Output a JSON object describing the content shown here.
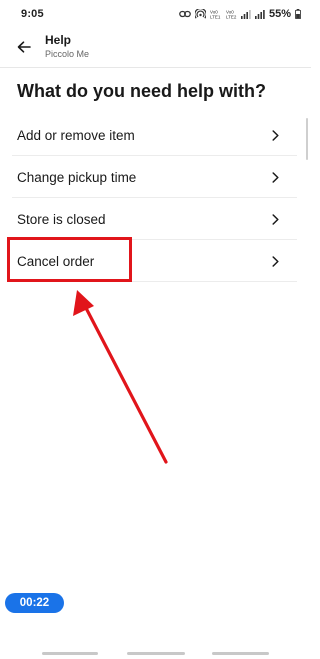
{
  "status_bar": {
    "time": "9:05",
    "battery": "55%",
    "icons": [
      "link-icon",
      "hotspot-icon",
      "volte-icon",
      "lte-icon",
      "signal-icon",
      "signal-icon",
      "battery-icon"
    ]
  },
  "header": {
    "title": "Help",
    "subtitle": "Piccolo Me",
    "back_icon": "arrow-left-icon"
  },
  "main": {
    "heading": "What do you need help with?",
    "items": [
      {
        "label": "Add or remove item",
        "icon": "chevron-right-icon"
      },
      {
        "label": "Change pickup time",
        "icon": "chevron-right-icon"
      },
      {
        "label": "Store is closed",
        "icon": "chevron-right-icon"
      },
      {
        "label": "Cancel order",
        "icon": "chevron-right-icon"
      }
    ]
  },
  "annotation": {
    "color": "#e1151b",
    "highlighted_item": "Cancel order"
  },
  "recording": {
    "timer": "00:22",
    "color": "#1a73e8"
  }
}
